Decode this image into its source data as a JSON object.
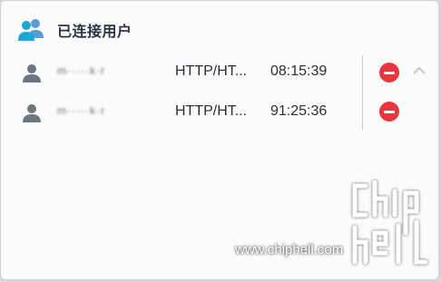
{
  "panel": {
    "title": "已连接用户",
    "title_icon": "users-icon"
  },
  "users": [
    {
      "name": "m·····k·r",
      "protocol": "HTTP/HT...",
      "duration": "08:15:39",
      "icon": "user-icon",
      "action_icon": "disconnect-icon"
    },
    {
      "name": "m·····k·r",
      "protocol": "HTTP/HT...",
      "duration": "91:25:36",
      "icon": "user-icon",
      "action_icon": "disconnect-icon"
    }
  ],
  "controls": {
    "collapse_icon": "chevron-up-icon"
  },
  "watermark": {
    "url": "www.chiphell.com",
    "logo_text": "chiphell"
  },
  "colors": {
    "accent": "#1a9fd8",
    "danger": "#e8363c",
    "text": "#2a2f35",
    "background": "#fbfbfc"
  }
}
